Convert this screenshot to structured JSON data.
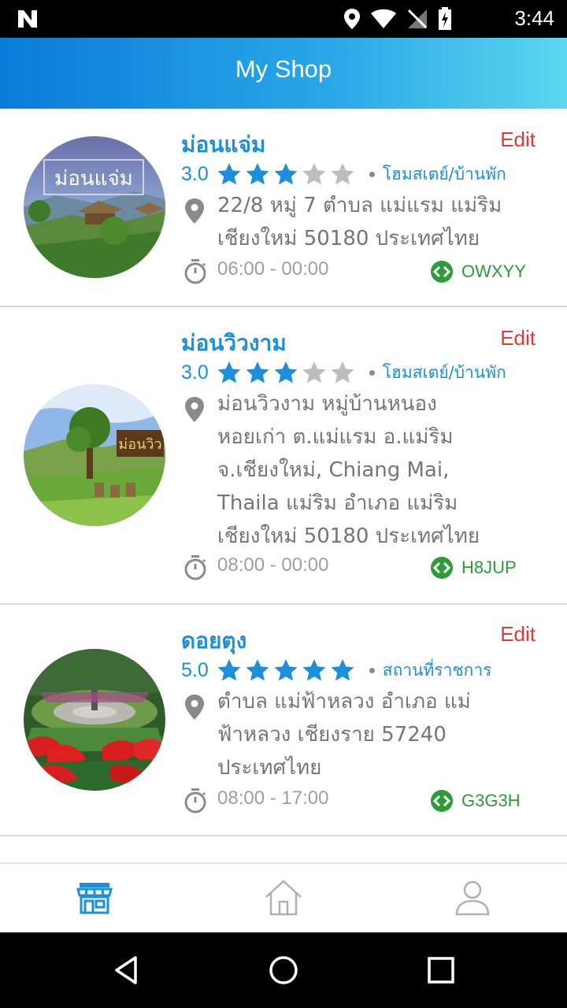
{
  "status_bar": {
    "time": "3:44"
  },
  "app_bar": {
    "title": "My Shop"
  },
  "shops": [
    {
      "name": "ม่อนแจ่ม",
      "edit_label": "Edit",
      "rating": "3.0",
      "stars_filled": 3,
      "category": "โฮมสเตย์/บ้านพัก",
      "address_lines": [
        "22/8 หมู่ 7 ตำบล แม่แรม แม่ริม",
        "เชียงใหม่ 50180 ประเทศไทย"
      ],
      "hours": "06:00 - 00:00",
      "code": "OWXYY",
      "thumb_label": "ม่อนแจ่ม"
    },
    {
      "name": "ม่อนวิวงาม",
      "edit_label": "Edit",
      "rating": "3.0",
      "stars_filled": 3,
      "category": "โฮมสเตย์/บ้านพัก",
      "address_lines": [
        "ม่อนวิวงาม หมู่บ้านหนอง",
        "หอยเก่า ต.แม่แรม อ.แม่ริม",
        "จ.เชียงใหม่, Chiang Mai,",
        "Thaila แม่ริม อำเภอ แม่ริม",
        "เชียงใหม่ 50180 ประเทศไทย"
      ],
      "hours": "08:00 - 00:00",
      "code": "H8JUP",
      "thumb_label": "ม่อนวิว"
    },
    {
      "name": "ดอยตุง",
      "edit_label": "Edit",
      "rating": "5.0",
      "stars_filled": 5,
      "category": "สถานที่ราชการ",
      "address_lines": [
        "ตำบล แม่ฟ้าหลวง อำเภอ แม่",
        "ฟ้าหลวง เชียงราย 57240",
        "ประเทศไทย"
      ],
      "hours": "08:00 - 17:00",
      "code": "G3G3H"
    }
  ],
  "colors": {
    "accent": "#1b8fdc",
    "edit": "#e53935",
    "code": "#2e9b3a",
    "star_filled": "#1b8fdc",
    "star_empty": "#bdbdbd"
  },
  "bottom_nav": [
    {
      "icon": "store-icon",
      "active": true
    },
    {
      "icon": "home-icon",
      "active": false
    },
    {
      "icon": "profile-icon",
      "active": false
    }
  ]
}
